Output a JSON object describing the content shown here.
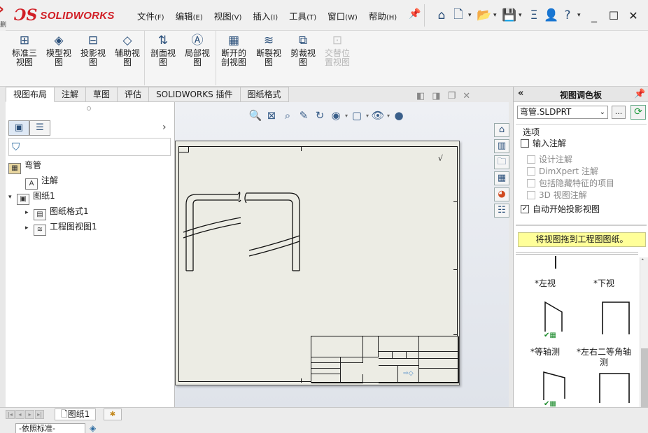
{
  "app": {
    "logo_ds": "ƆS",
    "logo_name": "SOLIDWORKS",
    "left_stub": "删"
  },
  "menu": [
    {
      "label": "文件",
      "key": "(F)"
    },
    {
      "label": "编辑",
      "key": "(E)"
    },
    {
      "label": "视图",
      "key": "(V)"
    },
    {
      "label": "插入",
      "key": "(I)"
    },
    {
      "label": "工具",
      "key": "(T)"
    },
    {
      "label": "窗口",
      "key": "(W)"
    },
    {
      "label": "帮助",
      "key": "(H)"
    }
  ],
  "quick_access": {
    "home_icon": "⌂",
    "new_icon": "🗋",
    "open_icon": "📂",
    "save_icon": "💾",
    "print_icon": "Ξ",
    "user_icon": "👤",
    "help_icon": "?",
    "minimize": "_",
    "maximize": "☐",
    "close": "✕"
  },
  "ribbon": [
    {
      "line1": "标准三",
      "line2": "视图",
      "icon": "⊞",
      "disabled": false
    },
    {
      "line1": "模型视",
      "line2": "图",
      "icon": "◈",
      "disabled": false
    },
    {
      "line1": "投影视",
      "line2": "图",
      "icon": "⊟",
      "disabled": false
    },
    {
      "line1": "辅助视",
      "line2": "图",
      "icon": "◇",
      "disabled": false
    },
    {
      "line1": "剖面视",
      "line2": "图",
      "icon": "⇅",
      "disabled": false
    },
    {
      "line1": "局部视",
      "line2": "图",
      "icon": "Ⓐ",
      "disabled": false
    },
    {
      "line1": "断开的",
      "line2": "剖视图",
      "icon": "▦",
      "disabled": false
    },
    {
      "line1": "断裂视",
      "line2": "图",
      "icon": "≋",
      "disabled": false
    },
    {
      "line1": "剪裁视",
      "line2": "图",
      "icon": "⧉",
      "disabled": false
    },
    {
      "line1": "交替位",
      "line2": "置视图",
      "icon": "⊡",
      "disabled": true
    }
  ],
  "tabs": [
    {
      "label": "视图布局",
      "active": true
    },
    {
      "label": "注解",
      "active": false
    },
    {
      "label": "草图",
      "active": false
    },
    {
      "label": "评估",
      "active": false
    },
    {
      "label": "SOLIDWORKS 插件",
      "active": false
    },
    {
      "label": "图纸格式",
      "active": false
    }
  ],
  "feature_tree": {
    "root": "弯管",
    "items": [
      {
        "label": "注解",
        "level": 1,
        "toggle": ""
      },
      {
        "label": "图纸1",
        "level": 0,
        "toggle": "▾"
      },
      {
        "label": "图纸格式1",
        "level": 2,
        "toggle": "▸"
      },
      {
        "label": "工程图视图1",
        "level": 2,
        "toggle": "▸"
      }
    ],
    "expand_arrow": "›"
  },
  "graphics": {
    "toolbar_icons": [
      "🔍",
      "⊠",
      "⌕",
      "✎",
      "↻",
      "◉",
      "▢",
      "👁",
      "●"
    ],
    "window_controls": [
      "◧",
      "◨",
      "❐",
      "✕"
    ],
    "sheet_mark": "√"
  },
  "right_panel": {
    "title": "视图调色板",
    "collapse": "«",
    "pin": "📌",
    "combo_value": "弯管.SLDPRT",
    "browse": "...",
    "refresh": "⟳",
    "options_legend": "选项",
    "options": [
      {
        "label": "输入注解",
        "checked": false,
        "sub": false
      },
      {
        "label": "设计注解",
        "checked": false,
        "sub": true
      },
      {
        "label": "DimXpert 注解",
        "checked": false,
        "sub": true
      },
      {
        "label": "包括隐藏特征的项目",
        "checked": false,
        "sub": true
      },
      {
        "label": "3D 视图注解",
        "checked": false,
        "sub": true
      },
      {
        "label": "自动开始投影视图",
        "checked": true,
        "sub": false
      }
    ],
    "drag_hint": "将视图拖到工程图图纸。",
    "views": [
      {
        "label": "*左视",
        "line2": ""
      },
      {
        "label": "*下视",
        "line2": ""
      },
      {
        "label": "*等轴测",
        "line2": ""
      },
      {
        "label": "*左右二等角轴",
        "line2": "测"
      }
    ]
  },
  "status": {
    "sheet_tab": "图纸1",
    "standard": "-依照标准-"
  }
}
